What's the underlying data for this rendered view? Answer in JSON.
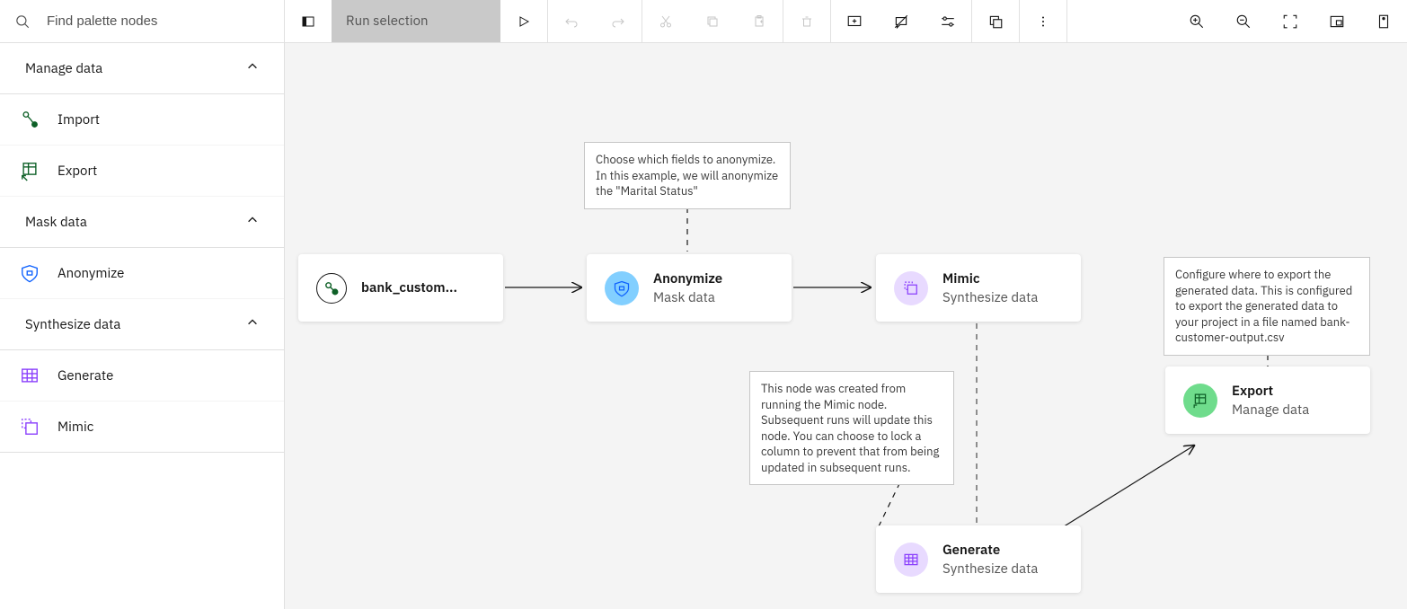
{
  "search": {
    "placeholder": "Find palette nodes"
  },
  "toolbar": {
    "run_selection": "Run selection"
  },
  "sidebar": {
    "sections": {
      "manage_data": "Manage data",
      "mask_data": "Mask data",
      "synthesize_data": "Synthesize data"
    },
    "items": {
      "import": "Import",
      "export": "Export",
      "anonymize": "Anonymize",
      "generate": "Generate",
      "mimic": "Mimic"
    }
  },
  "canvas": {
    "nodes": {
      "bank": {
        "title": "bank_custom..."
      },
      "anonymize": {
        "title": "Anonymize",
        "sub": "Mask data"
      },
      "mimic": {
        "title": "Mimic",
        "sub": "Synthesize data"
      },
      "generate": {
        "title": "Generate",
        "sub": "Synthesize data"
      },
      "export": {
        "title": "Export",
        "sub": "Manage data"
      }
    },
    "comments": {
      "c1": "Choose which fields to anonymize. In this example, we will anonymize the \"Marital Status\"",
      "c2": "This node was created from running the Mimic node. Subsequent runs will update this node. You can choose to lock a column to prevent that from being updated in subsequent runs.",
      "c3": "Configure where to export the generated data. This is configured to export the generated data to your project in a file named bank-customer-output.csv"
    }
  },
  "colors": {
    "green": "#24a148",
    "blue": "#0f62fe",
    "purple": "#8a3ffc"
  }
}
